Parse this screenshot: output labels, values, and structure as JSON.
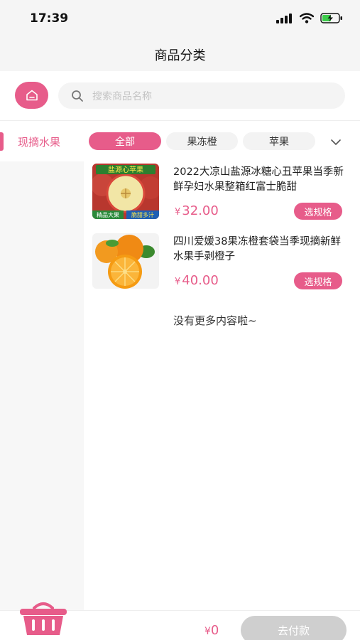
{
  "status_bar": {
    "time": "17:39"
  },
  "nav": {
    "title": "商品分类"
  },
  "search": {
    "placeholder": "搜索商品名称"
  },
  "sidebar": {
    "items": [
      {
        "label": "现摘水果",
        "active": true
      }
    ]
  },
  "tabs": [
    {
      "label": "全部",
      "active": true
    },
    {
      "label": "果冻橙",
      "active": false
    },
    {
      "label": "苹果",
      "active": false
    }
  ],
  "products": [
    {
      "title": "2022大凉山盐源冰糖心丑苹果当季新鲜孕妇水果整箱红富士脆甜",
      "currency": "¥",
      "price": "32.00",
      "button_label": "选规格",
      "image_top_text": "盐源心苹果",
      "image_bottom_left_text": "精品大果",
      "image_bottom_right_text": "脆甜多汁",
      "image_icon": "apple-icon"
    },
    {
      "title": "四川爱媛38果冻橙套袋当季现摘新鲜水果手剥橙子",
      "currency": "¥",
      "price": "40.00",
      "button_label": "选规格",
      "image_icon": "orange-icon"
    }
  ],
  "list_end_text": "没有更多内容啦~",
  "footer": {
    "currency": "¥",
    "total": "0",
    "pay_label": "去付款"
  },
  "colors": {
    "accent": "#e75c8a",
    "pay_disabled": "#cfcfcf",
    "sidebar_bg": "#f7f7f7",
    "header_bg": "#f5f5f5"
  }
}
